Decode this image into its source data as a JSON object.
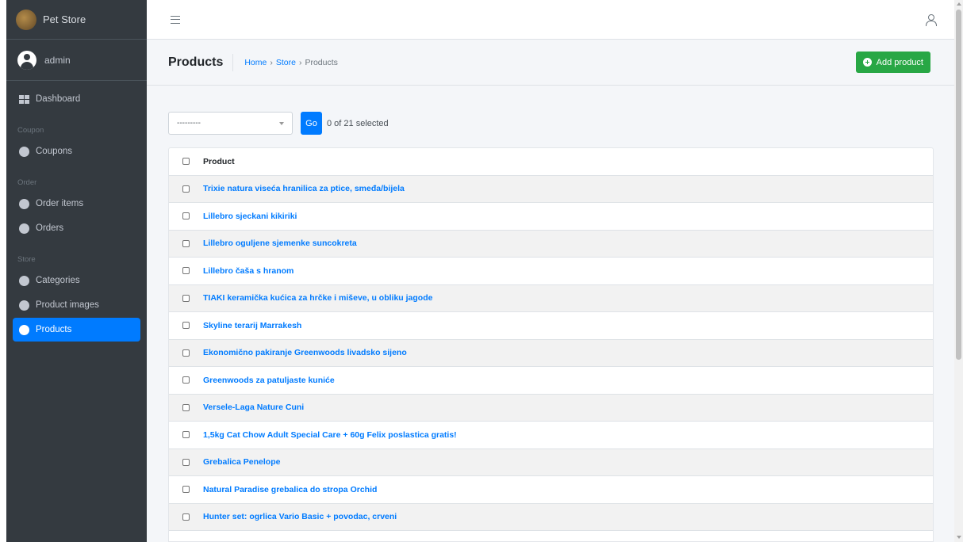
{
  "brand": {
    "name": "Pet Store"
  },
  "user": {
    "name": "admin"
  },
  "sidebar": {
    "dashboard": "Dashboard",
    "sections": [
      {
        "header": "Coupon",
        "items": [
          "Coupons"
        ]
      },
      {
        "header": "Order",
        "items": [
          "Order items",
          "Orders"
        ]
      },
      {
        "header": "Store",
        "items": [
          "Categories",
          "Product images",
          "Products"
        ]
      }
    ],
    "active_item": "Products"
  },
  "header": {
    "title": "Products",
    "breadcrumb": [
      "Home",
      "Store",
      "Products"
    ],
    "breadcrumb_separator": "›",
    "add_button": "Add product"
  },
  "actions": {
    "select_value": "---------",
    "go_label": "Go",
    "selected_text": "0 of 21 selected"
  },
  "table": {
    "column_header": "Product",
    "rows": [
      "Trixie natura viseća hranilica za ptice, smeđa/bijela",
      "Lillebro sjeckani kikiriki",
      "Lillebro oguljene sjemenke suncokreta",
      "Lillebro čaša s hranom",
      "TIAKI keramička kućica za hrčke i miševe, u obliku jagode",
      "Skyline terarij Marrakesh",
      "Ekonomično pakiranje Greenwoods livadsko sijeno",
      "Greenwoods za patuljaste kuniće",
      "Versele-Laga Nature Cuni",
      "1,5kg Cat Chow Adult Special Care + 60g Felix poslastica gratis!",
      "Grebalica Penelope",
      "Natural Paradise grebalica do stropa Orchid",
      "Hunter set: ogrlica Vario Basic + povodac, crveni"
    ]
  },
  "colors": {
    "sidebar_bg": "#343a40",
    "accent": "#007bff",
    "success": "#28a745"
  }
}
